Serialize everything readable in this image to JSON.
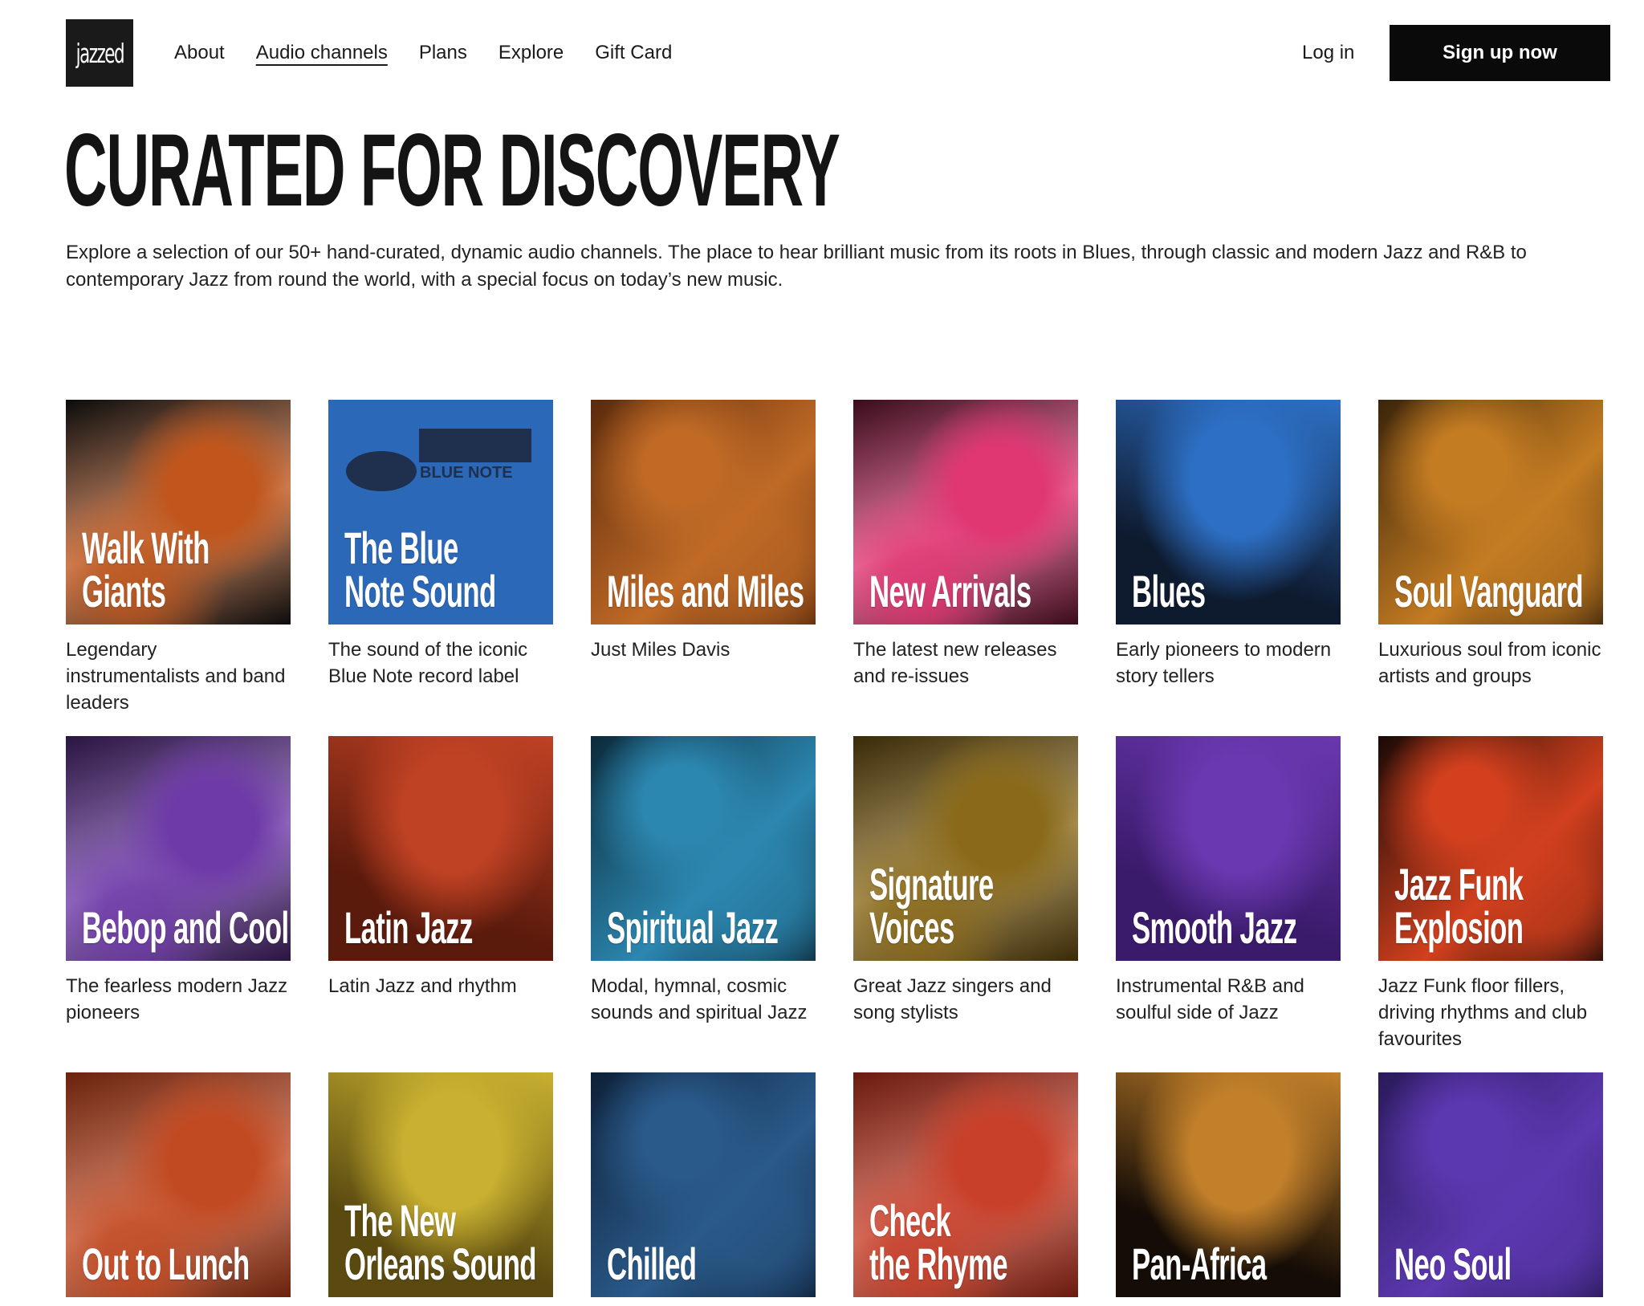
{
  "header": {
    "logo_text": "jazzed",
    "nav": [
      {
        "label": "About",
        "active": false
      },
      {
        "label": "Audio channels",
        "active": true
      },
      {
        "label": "Plans",
        "active": false
      },
      {
        "label": "Explore",
        "active": false
      },
      {
        "label": "Gift Card",
        "active": false
      }
    ],
    "login_label": "Log in",
    "signup_label": "Sign up now"
  },
  "hero": {
    "title": "CURATED FOR DISCOVERY",
    "description": "Explore a selection of our 50+ hand-curated, dynamic audio channels. The place to hear brilliant music from its roots in Blues, through classic and modern Jazz and R&B to contemporary Jazz from round the world, with a special focus on today’s new music."
  },
  "channels": [
    {
      "title": "Walk With\nGiants",
      "description": "Legendary instrumentalists and band leaders",
      "color": "#c0561c",
      "bg": "#0c0c0c"
    },
    {
      "title": "The Blue\nNote Sound",
      "description": "The sound of the iconic Blue Note record label",
      "color": "#2c68b8",
      "bg": "#2c68b8",
      "badge": "BLUE NOTE"
    },
    {
      "title": "Miles and Miles",
      "description": "Just Miles Davis",
      "color": "#c06a26",
      "bg": "#5a2a0c"
    },
    {
      "title": "New Arrivals",
      "description": "The latest new releases and re-issues",
      "color": "#e03672",
      "bg": "#3a0c1c"
    },
    {
      "title": "Blues",
      "description": "Early pioneers to modern story tellers",
      "color": "#2d6fc4",
      "bg": "#0e1a2e"
    },
    {
      "title": "Soul Vanguard",
      "description": "Luxurious soul from iconic artists and groups",
      "color": "#c47c22",
      "bg": "#3a240a"
    },
    {
      "title": "Bebop and Cool",
      "description": "The fearless modern Jazz pioneers",
      "color": "#6e3aa8",
      "bg": "#2a1540"
    },
    {
      "title": "Latin Jazz",
      "description": "Latin Jazz and rhythm",
      "color": "#c04224",
      "bg": "#5a1a0c"
    },
    {
      "title": "Spiritual Jazz",
      "description": "Modal, hymnal, cosmic sounds and spiritual Jazz",
      "color": "#2c87b0",
      "bg": "#0c2a3a"
    },
    {
      "title": "Signature Voices",
      "description": "Great Jazz singers and song stylists",
      "color": "#8a6a1a",
      "bg": "#3a2a08"
    },
    {
      "title": "Smooth Jazz",
      "description": "Instrumental R&B and soulful side of Jazz",
      "color": "#6a38b0",
      "bg": "#3a1a6a"
    },
    {
      "title": "Jazz Funk\nExplosion",
      "description": "Jazz Funk floor fillers, driving rhythms and club favourites",
      "color": "#d2401e",
      "bg": "#1a0a06"
    },
    {
      "title": "Out to Lunch",
      "description": "",
      "color": "#c24a22",
      "bg": "#6a220c"
    },
    {
      "title": "The New\nOrleans Sound",
      "description": "",
      "color": "#c8b030",
      "bg": "#5a4a10"
    },
    {
      "title": "Chilled",
      "description": "",
      "color": "#2a5a8a",
      "bg": "#0e2038"
    },
    {
      "title": "Check\nthe Rhyme",
      "description": "",
      "color": "#c8402a",
      "bg": "#6a1a0e"
    },
    {
      "title": "Pan-Africa",
      "description": "",
      "color": "#c2802a",
      "bg": "#140c06"
    },
    {
      "title": "Neo Soul",
      "description": "",
      "color": "#5c38b0",
      "bg": "#2a1a5a"
    }
  ]
}
